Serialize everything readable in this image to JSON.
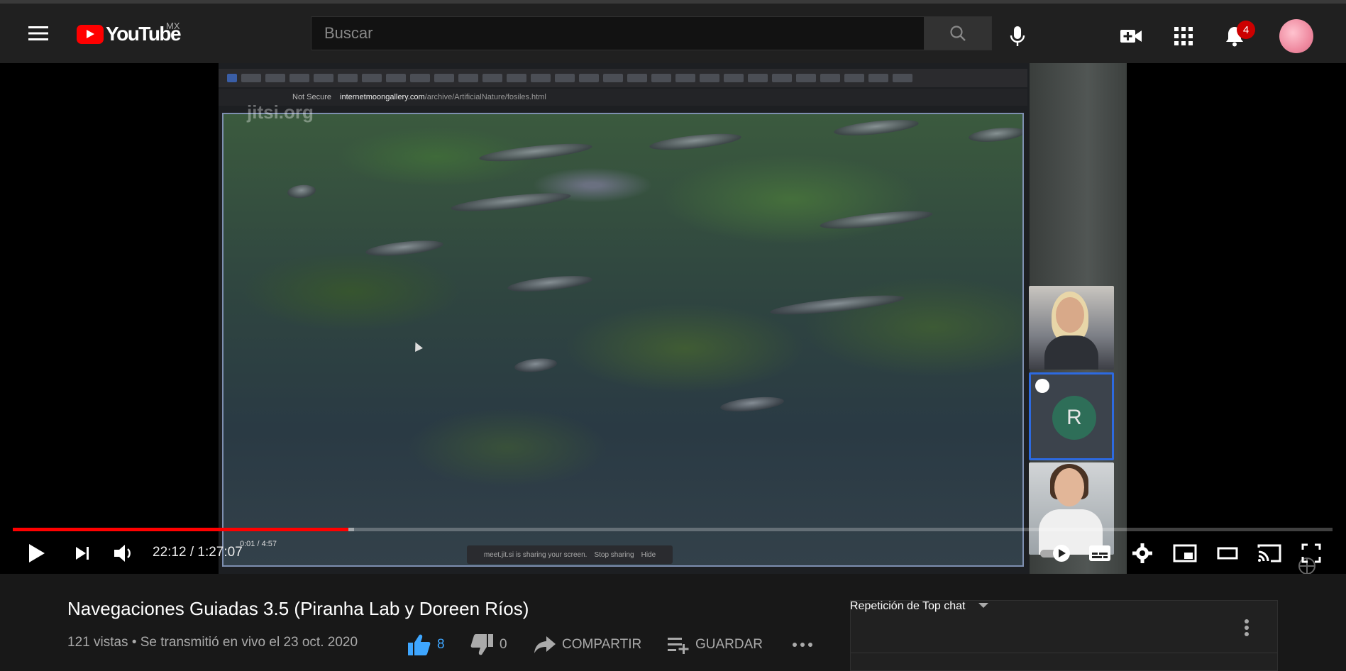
{
  "header": {
    "logo_word": "YouTube",
    "country": "MX",
    "search_placeholder": "Buscar",
    "notifications_count": "4"
  },
  "player": {
    "shared_screen": {
      "url_warning": "Not Secure",
      "url_host": "internetmoongallery.com",
      "url_path": "/archive/ArtificialNature/fosiles.html",
      "jitsi_watermark": "jitsi.org",
      "inner_time": "0:01 / 4:57",
      "sharing_text": "meet.jit.si is sharing your screen.",
      "stop_sharing": "Stop sharing",
      "hide": "Hide"
    },
    "participant_initial": "R",
    "time_display": "22:12 / 1:27:07",
    "progress_fraction": 0.2541,
    "buffer_fraction": 0.2585
  },
  "video": {
    "title": "Navegaciones Guiadas 3.5 (Piranha Lab y Doreen Ríos)",
    "meta": "121 vistas • Se transmitió en vivo el 23 oct. 2020",
    "likes": "8",
    "dislikes": "0",
    "share_label": "COMPARTIR",
    "save_label": "GUARDAR"
  },
  "chat": {
    "header": "Repetición de Top chat"
  },
  "colors": {
    "brand_red": "#ff0000",
    "progress_red": "#ff0000",
    "like_blue": "#3ea6ff",
    "badge_red": "#cc0000"
  }
}
